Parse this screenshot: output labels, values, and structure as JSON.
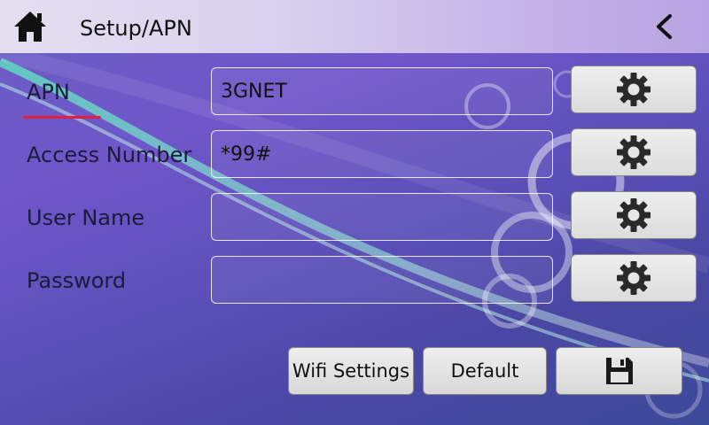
{
  "header": {
    "title": "Setup/APN",
    "home_icon": "home-icon",
    "back_icon": "chevron-left-icon"
  },
  "fields": [
    {
      "label": "APN",
      "value": "3GNET",
      "active": true
    },
    {
      "label": "Access Number",
      "value": "*99#",
      "active": false
    },
    {
      "label": "User Name",
      "value": "",
      "active": false
    },
    {
      "label": "Password",
      "value": "",
      "active": false
    }
  ],
  "field_button_icon": "gear-icon",
  "actions": {
    "wifi_settings": "Wifi Settings",
    "default": "Default",
    "save_icon": "floppy-disk-icon"
  },
  "colors": {
    "active_underline": "#e12040",
    "button_face": "#e6e6e6"
  }
}
